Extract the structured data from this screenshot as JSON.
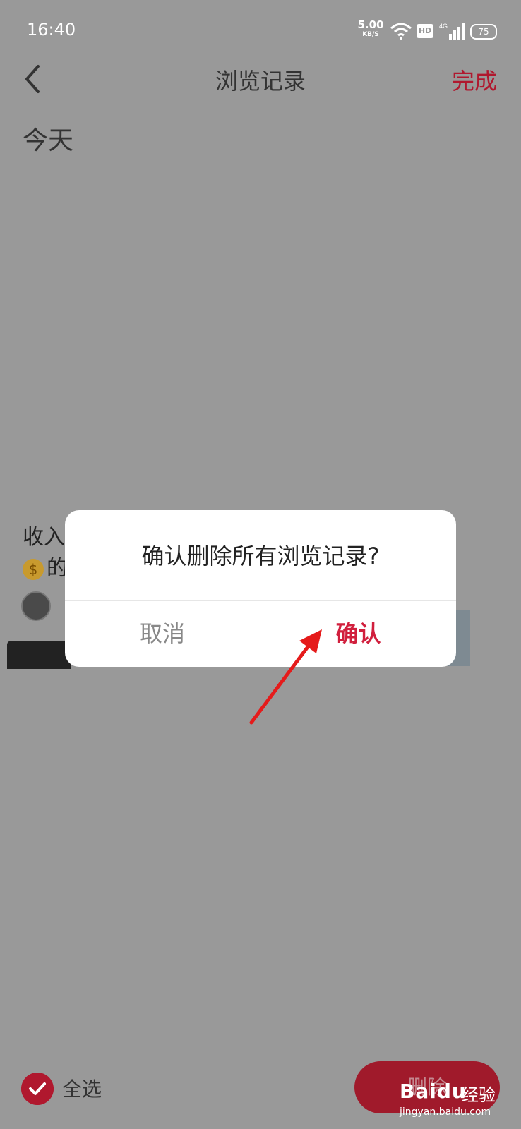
{
  "status_bar": {
    "time": "16:40",
    "net_speed_value": "5.00",
    "net_speed_unit": "KB/S",
    "hd_label": "HD",
    "network_type": "4G",
    "battery": "75"
  },
  "header": {
    "title": "浏览记录",
    "done_label": "完成"
  },
  "section": {
    "today_label": "今天"
  },
  "card": {
    "title_line1": "收入",
    "title_line2_suffix": "的",
    "coin_symbol": "$"
  },
  "dialog": {
    "message": "确认删除所有浏览记录?",
    "cancel_label": "取消",
    "confirm_label": "确认"
  },
  "bottom_bar": {
    "select_all_label": "全选",
    "delete_label": "删除"
  },
  "watermark": {
    "logo": "Baidu",
    "text": "经验",
    "sub": "jingyan.baidu.com"
  },
  "colors": {
    "overlay": "#999999",
    "accent": "#b0182e",
    "confirm": "#d11f3d"
  }
}
